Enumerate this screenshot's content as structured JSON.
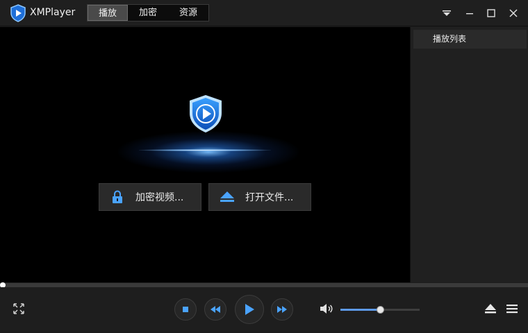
{
  "app": {
    "title": "XMPlayer",
    "tabs": [
      {
        "label": "播放",
        "active": true
      },
      {
        "label": "加密",
        "active": false
      },
      {
        "label": "资源",
        "active": false
      }
    ],
    "window_controls": [
      "dropdown-icon",
      "minimize-icon",
      "maximize-icon",
      "close-icon"
    ]
  },
  "video": {
    "buttons": {
      "encrypt": {
        "label": "加密视频...",
        "icon": "lock-icon"
      },
      "open": {
        "label": "打开文件...",
        "icon": "eject-icon"
      }
    }
  },
  "playlist": {
    "title": "播放列表"
  },
  "playback": {
    "progress": 0.0,
    "volume": 0.5
  },
  "colors": {
    "accent": "#4aa3ff",
    "background": "#1c1c1c",
    "video_bg": "#000000"
  }
}
